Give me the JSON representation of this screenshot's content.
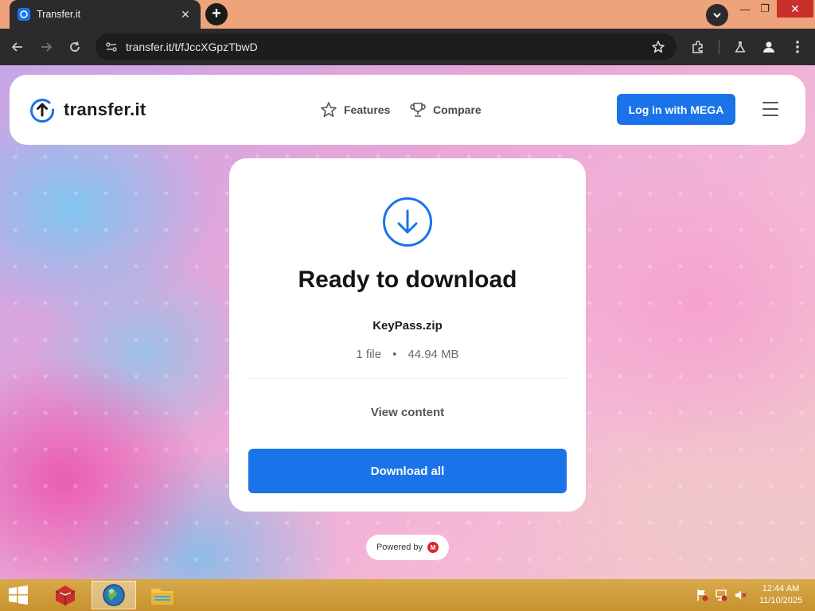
{
  "browser": {
    "tab_title": "Transfer.it",
    "tab_close": "✕",
    "new_tab": "+",
    "url": "transfer.it/t/fJccXGpzTbwD",
    "window_controls": {
      "minimize": "—",
      "maximize": "❐",
      "close": "✕"
    }
  },
  "site": {
    "logo_text": "transfer.it",
    "nav": [
      {
        "label": "Features",
        "icon": "star-icon"
      },
      {
        "label": "Compare",
        "icon": "trophy-icon"
      }
    ],
    "login_label": "Log in with MEGA"
  },
  "card": {
    "title": "Ready to download",
    "file_name": "KeyPass.zip",
    "file_count": "1 file",
    "separator": "•",
    "file_size": "44.94 MB",
    "view_content_label": "View content",
    "download_label": "Download all"
  },
  "powered_by": {
    "label": "Powered by",
    "badge": "M"
  },
  "taskbar": {
    "time": "12:44 AM",
    "date": "11/10/2025"
  },
  "colors": {
    "accent": "#1a73e8",
    "mega_red": "#d9272e",
    "tab_strip": "#eea37a",
    "toolbar": "#2b2b2e"
  }
}
